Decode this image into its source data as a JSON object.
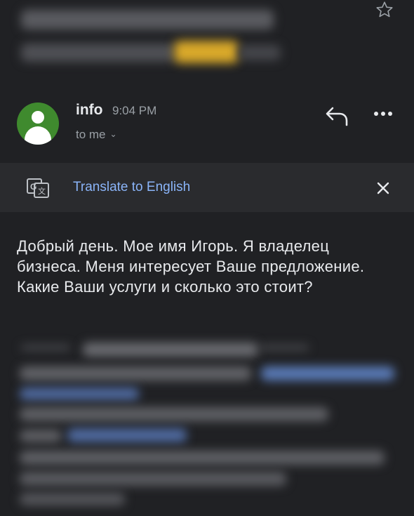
{
  "header": {
    "star_icon": "star-outline-icon"
  },
  "sender": {
    "name": "info",
    "time": "9:04 PM",
    "recipient": "to me",
    "avatar_color": "#3f8a2e"
  },
  "actions": {
    "reply_icon": "reply-icon",
    "more_icon": "more-horiz-icon"
  },
  "translate": {
    "label": "Translate to English",
    "icon": "google-translate-icon",
    "close_icon": "close-icon",
    "link_color": "#8ab4f8"
  },
  "message": {
    "body": "Добрый день. Мое имя Игорь. Я владелец бизнеса. Меня интересует Ваше предложение. Какие Ваши услуги и сколько это стоит?"
  },
  "colors": {
    "background": "#202124",
    "bar": "#2a2b2e",
    "text": "#e8eaed",
    "muted": "#9aa0a6"
  }
}
